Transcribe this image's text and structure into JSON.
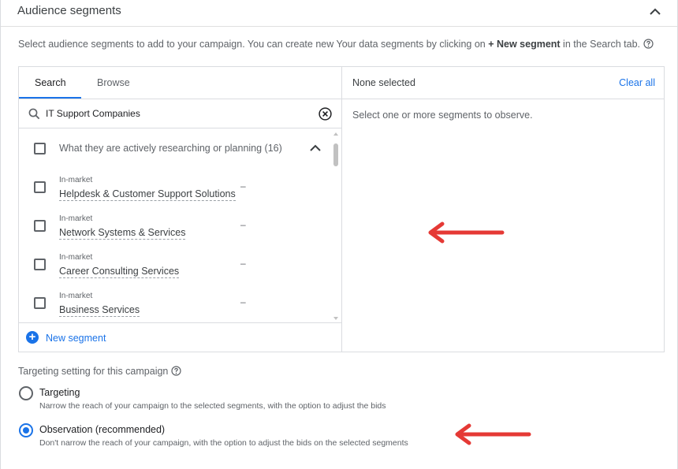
{
  "header": {
    "title": "Audience segments"
  },
  "intro": {
    "text_before": "Select audience segments to add to your campaign. You can create new Your data segments by clicking on ",
    "bold": "+ New segment",
    "text_after": " in the Search tab."
  },
  "tabs": [
    {
      "label": "Search"
    },
    {
      "label": "Browse"
    }
  ],
  "search": {
    "value": "IT Support Companies"
  },
  "group": {
    "label": "What they are actively researching or planning (16)"
  },
  "segments": [
    {
      "category": "In-market",
      "name": "Helpdesk & Customer Support Solutions",
      "dash": "–"
    },
    {
      "category": "In-market",
      "name": "Network Systems & Services",
      "dash": "–"
    },
    {
      "category": "In-market",
      "name": "Career Consulting Services",
      "dash": "–"
    },
    {
      "category": "In-market",
      "name": "Business Services",
      "dash": "–"
    }
  ],
  "new_segment": {
    "label": "New segment"
  },
  "selected_panel": {
    "title": "None selected",
    "clear_all": "Clear all",
    "empty_message": "Select one or more segments to observe."
  },
  "targeting": {
    "title": "Targeting setting for this campaign",
    "options": [
      {
        "label": "Targeting",
        "description": "Narrow the reach of your campaign to the selected segments, with the option to adjust the bids",
        "selected": false
      },
      {
        "label": "Observation (recommended)",
        "description": "Don't narrow the reach of your campaign, with the option to adjust the bids on the selected segments",
        "selected": true
      }
    ]
  },
  "colors": {
    "accent": "#1a73e8",
    "annotation_arrow": "#e53935"
  }
}
